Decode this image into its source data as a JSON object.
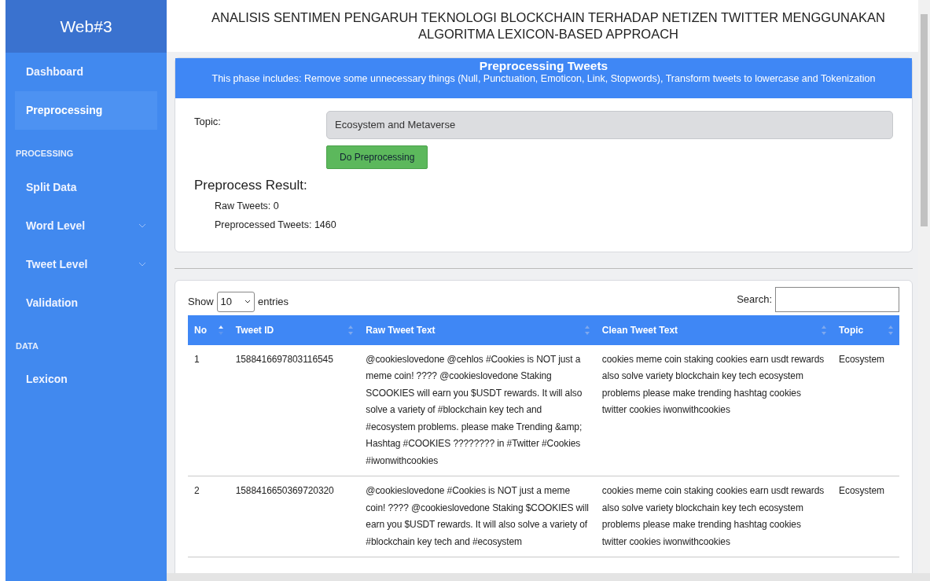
{
  "sidebar": {
    "brand": "Web#3",
    "items": [
      {
        "kind": "link",
        "label": "Dashboard",
        "selected": false
      },
      {
        "kind": "link",
        "label": "Preprocessing",
        "selected": true
      },
      {
        "kind": "heading",
        "label": "PROCESSING"
      },
      {
        "kind": "link",
        "label": "Split Data",
        "selected": false
      },
      {
        "kind": "dropdown",
        "label": "Word Level",
        "selected": false
      },
      {
        "kind": "dropdown",
        "label": "Tweet Level",
        "selected": false
      },
      {
        "kind": "link",
        "label": "Validation",
        "selected": false
      },
      {
        "kind": "heading",
        "label": "DATA"
      },
      {
        "kind": "link",
        "label": "Lexicon",
        "selected": false
      }
    ]
  },
  "header": {
    "title": "ANALISIS SENTIMEN PENGARUH TEKNOLOGI BLOCKCHAIN TERHADAP NETIZEN TWITTER MENGGUNAKAN ALGORITMA LEXICON-BASED APPROACH"
  },
  "preprocess_card": {
    "title": "Preprocessing Tweets",
    "subtitle": "This phase includes: Remove some unnecessary things (Null, Punctuation, Emoticon, Link, Stopwords), Transform tweets to lowercase and Tokenization",
    "topic_label": "Topic:",
    "topic_value": "Ecosystem and Metaverse",
    "button": "Do Preprocessing",
    "result_title": "Preprocess Result:",
    "results": [
      "Raw Tweets: 0",
      "Preprocessed Tweets: 1460"
    ]
  },
  "table": {
    "show_label": "Show",
    "page_size": "10",
    "entries_label": "entries",
    "search_label": "Search:",
    "columns": [
      {
        "label": "No",
        "sorted": true
      },
      {
        "label": "Tweet ID",
        "sorted": false
      },
      {
        "label": "Raw Tweet Text",
        "sorted": false
      },
      {
        "label": "Clean Tweet Text",
        "sorted": false
      },
      {
        "label": "Topic",
        "sorted": false
      }
    ],
    "rows": [
      [
        "1",
        "1588416697803116545",
        "@cookieslovedone @cehlos #Cookies is NOT just a meme coin! ???? @cookieslovedone Staking SCOOKIES will earn you $USDT rewards. It will also solve a variety of #blockchain key tech and #ecosystem problems. please make Trending &amp; Hashtag #COOKIES ???????? in #Twitter #Cookies #iwonwithcookies",
        "cookies meme coin staking cookies earn usdt rewards also solve variety blockchain key tech ecosystem problems please make trending hashtag cookies twitter cookies iwonwithcookies",
        "Ecosystem"
      ],
      [
        "2",
        "1588416650369720320",
        "@cookieslovedone #Cookies is NOT just a meme coin! ???? @cookieslovedone Staking $COOKIES will earn you $USDT rewards. It will also solve a variety of #blockchain key tech and #ecosystem",
        "cookies meme coin staking cookies earn usdt rewards also solve variety blockchain key tech ecosystem problems please make trending hashtag cookies twitter cookies iwonwithcookies",
        "Ecosystem"
      ]
    ]
  }
}
